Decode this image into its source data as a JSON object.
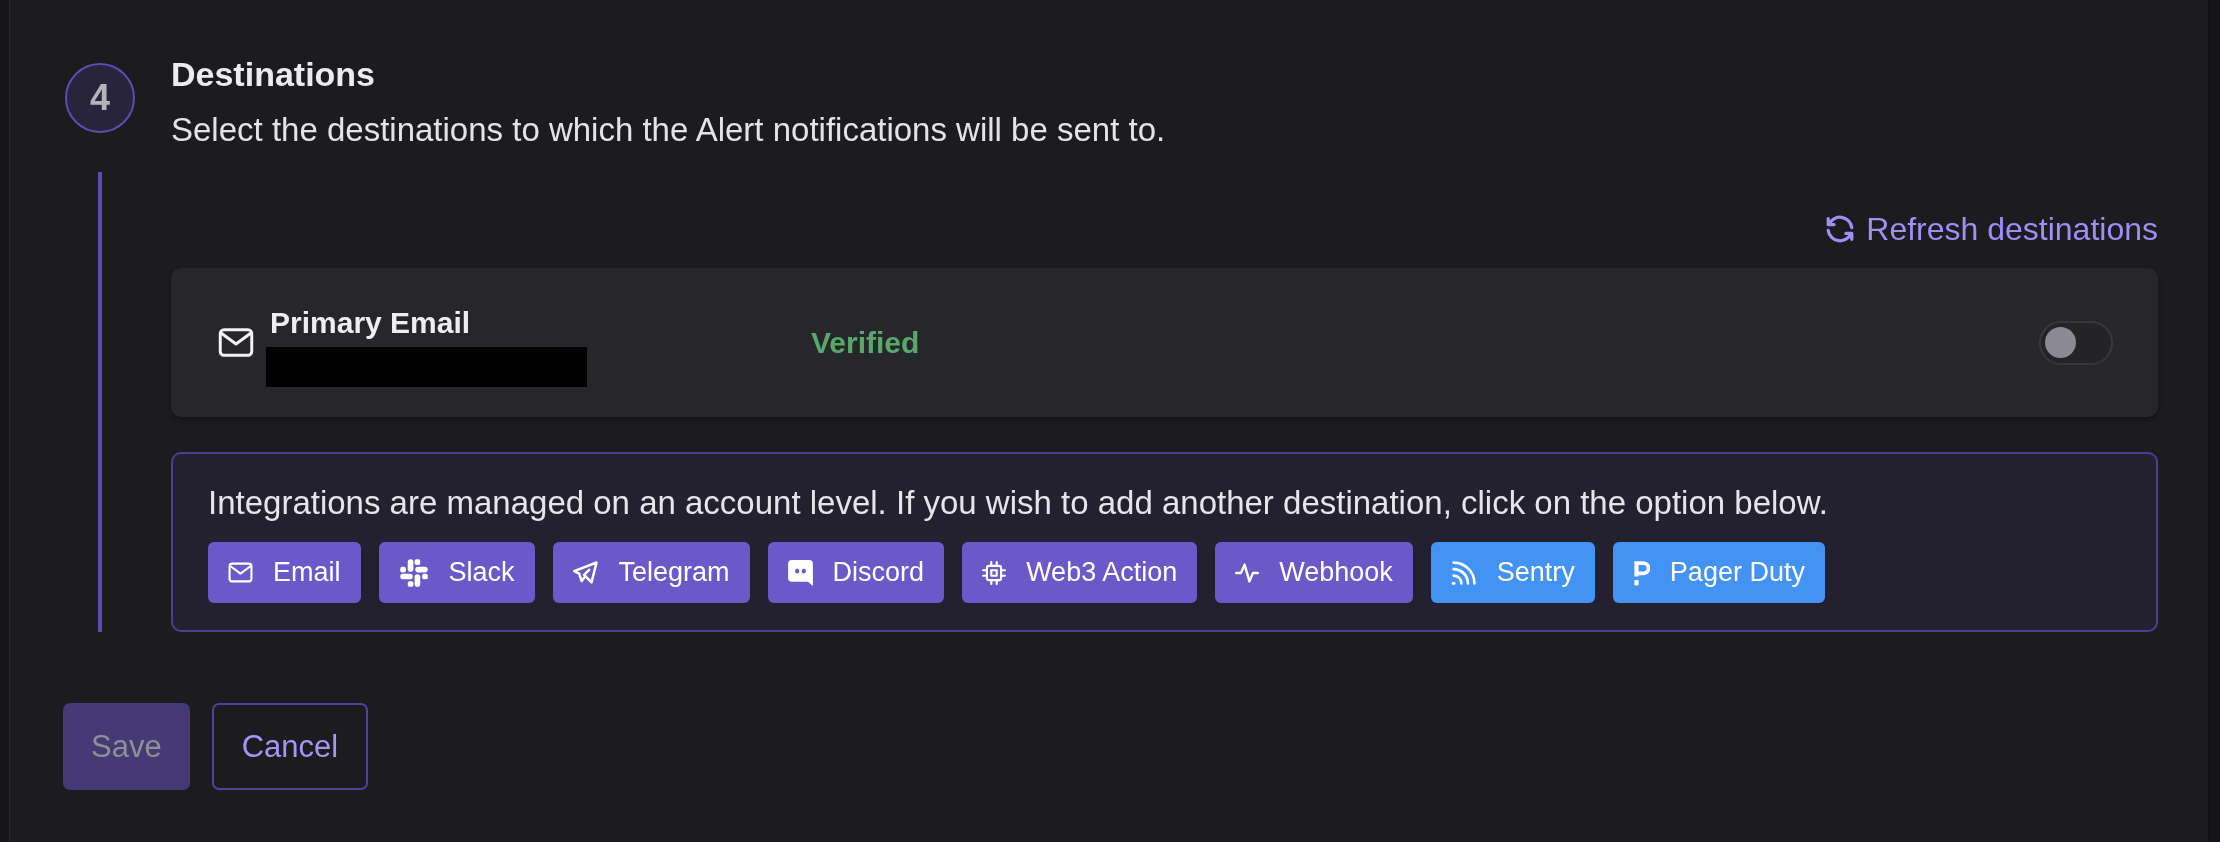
{
  "step": {
    "number": "4",
    "title": "Destinations",
    "description": "Select the destinations to which the Alert notifications will be sent to."
  },
  "refresh_link": {
    "label": "Refresh destinations"
  },
  "destinations": [
    {
      "kind": "email",
      "name": "Primary Email",
      "address_redacted": true,
      "status": "Verified",
      "on": false
    }
  ],
  "integrations": {
    "note": "Integrations are managed on an account level. If you wish to add another destination, click on the option below.",
    "items": [
      {
        "kind": "email",
        "label": "Email",
        "color": "#6b58c9"
      },
      {
        "kind": "slack",
        "label": "Slack",
        "color": "#6b58c9"
      },
      {
        "kind": "telegram",
        "label": "Telegram",
        "color": "#6b58c9"
      },
      {
        "kind": "discord",
        "label": "Discord",
        "color": "#6b58c9"
      },
      {
        "kind": "web3",
        "label": "Web3 Action",
        "color": "#6b58c9"
      },
      {
        "kind": "webhook",
        "label": "Webhook",
        "color": "#6b58c9"
      },
      {
        "kind": "sentry",
        "label": "Sentry",
        "color": "#4393f5"
      },
      {
        "kind": "pagerduty",
        "label": "Pager Duty",
        "color": "#4393f5"
      }
    ]
  },
  "actions": [
    {
      "kind": "submit",
      "label": "Save",
      "disabled": true
    },
    {
      "kind": "cancel",
      "label": "Cancel",
      "disabled": false
    }
  ]
}
